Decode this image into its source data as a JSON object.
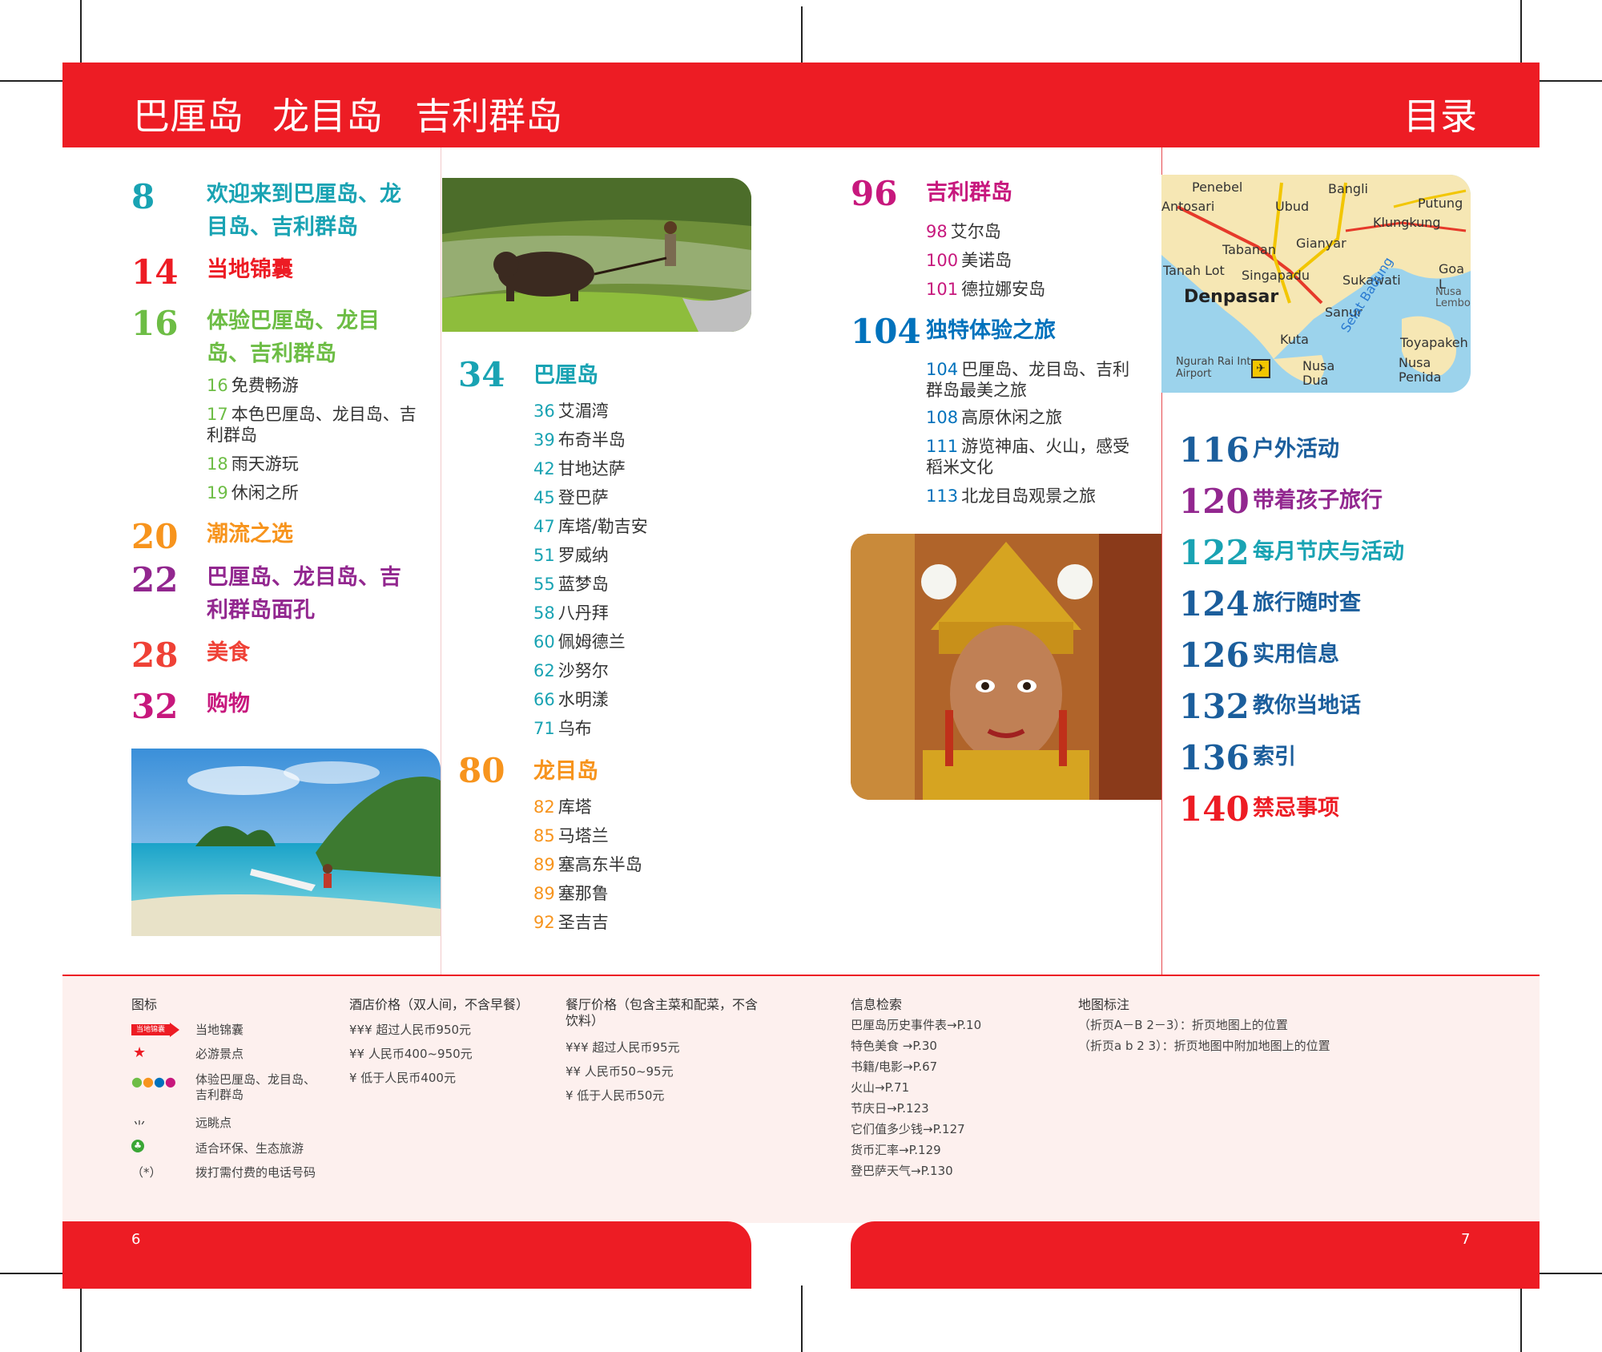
{
  "header": {
    "left_title_1": "巴厘岛",
    "left_title_2": "龙目岛",
    "left_title_3": "吉利群岛",
    "right_title": "目录"
  },
  "toc_col1": [
    {
      "num": "8",
      "title": "欢迎来到巴厘岛、龙目岛、吉利群岛",
      "color": "#19a3b3"
    },
    {
      "num": "14",
      "title": "当地锦囊",
      "color": "#ed1c24"
    },
    {
      "num": "16",
      "title": "体验巴厘岛、龙目岛、吉利群岛",
      "color": "#6dbd45",
      "subs": [
        {
          "n": "16",
          "t": "免费畅游"
        },
        {
          "n": "17",
          "t": "本色巴厘岛、龙目岛、吉利群岛"
        },
        {
          "n": "18",
          "t": "雨天游玩"
        },
        {
          "n": "19",
          "t": "休闲之所"
        }
      ]
    },
    {
      "num": "20",
      "title": "潮流之选",
      "color": "#f7941d"
    },
    {
      "num": "22",
      "title": "巴厘岛、龙目岛、吉利群岛面孔",
      "color": "#92278f"
    },
    {
      "num": "28",
      "title": "美食",
      "color": "#ef4136"
    },
    {
      "num": "32",
      "title": "购物",
      "color": "#c7187d"
    }
  ],
  "toc_col2": [
    {
      "num": "34",
      "title": "巴厘岛",
      "color": "#19a3b3",
      "subs": [
        {
          "n": "36",
          "t": "艾湄湾"
        },
        {
          "n": "39",
          "t": "布奇半岛"
        },
        {
          "n": "42",
          "t": "甘地达萨"
        },
        {
          "n": "45",
          "t": "登巴萨"
        },
        {
          "n": "47",
          "t": "库塔/勒吉安"
        },
        {
          "n": "51",
          "t": "罗威纳"
        },
        {
          "n": "55",
          "t": "蓝梦岛"
        },
        {
          "n": "58",
          "t": "八丹拜"
        },
        {
          "n": "60",
          "t": "佩姆德兰"
        },
        {
          "n": "62",
          "t": "沙努尔"
        },
        {
          "n": "66",
          "t": "水明漾"
        },
        {
          "n": "71",
          "t": "乌布"
        }
      ]
    },
    {
      "num": "80",
      "title": "龙目岛",
      "color": "#f7941d",
      "subs": [
        {
          "n": "82",
          "t": "库塔"
        },
        {
          "n": "85",
          "t": "马塔兰"
        },
        {
          "n": "89",
          "t": "塞高东半岛"
        },
        {
          "n": "89",
          "t": "塞那鲁"
        },
        {
          "n": "92",
          "t": "圣吉吉"
        }
      ]
    }
  ],
  "toc_col3": [
    {
      "num": "96",
      "title": "吉利群岛",
      "color": "#c7187d",
      "subs": [
        {
          "n": "98",
          "t": "艾尔岛"
        },
        {
          "n": "100",
          "t": "美诺岛"
        },
        {
          "n": "101",
          "t": "德拉娜安岛"
        }
      ]
    },
    {
      "num": "104",
      "title": "独特体验之旅",
      "color": "#0072bc",
      "subs": [
        {
          "n": "104",
          "t": "巴厘岛、龙目岛、吉利群岛最美之旅"
        },
        {
          "n": "108",
          "t": "高原休闲之旅"
        },
        {
          "n": "111",
          "t": "游览神庙、火山，感受稻米文化"
        },
        {
          "n": "113",
          "t": "北龙目岛观景之旅"
        }
      ]
    }
  ],
  "toc_col4": [
    {
      "num": "116",
      "title": "户外活动",
      "color": "#1b5e9c"
    },
    {
      "num": "120",
      "title": "带着孩子旅行",
      "color": "#92278f"
    },
    {
      "num": "122",
      "title": "每月节庆与活动",
      "color": "#19a3b3"
    },
    {
      "num": "124",
      "title": "旅行随时查",
      "color": "#1b5e9c"
    },
    {
      "num": "126",
      "title": "实用信息",
      "color": "#1b5e9c"
    },
    {
      "num": "132",
      "title": "教你当地话",
      "color": "#1b5e9c"
    },
    {
      "num": "136",
      "title": "索引",
      "color": "#1b5e9c"
    },
    {
      "num": "140",
      "title": "禁忌事项",
      "color": "#ed1c24"
    }
  ],
  "map": {
    "labels": [
      "Penebel",
      "Antosari",
      "Ubud",
      "Bangli",
      "Putung",
      "Klungkung",
      "Tabanan",
      "Gianyar",
      "Tanah Lot",
      "Singapadu",
      "Sukawati",
      "Goa L",
      "Denpasar",
      "Sanur",
      "Nusa Lembo",
      "Kuta",
      "Toyapakeh",
      "Ngurah Rai Int. Airport",
      "Nusa Dua",
      "Nusa Penida",
      "Selat Badung"
    ]
  },
  "legend": {
    "icons": {
      "title": "图标",
      "badge_text": "当地锦囊",
      "rows": [
        "当地锦囊",
        "必游景点",
        "体验巴厘岛、龙目岛、吉利群岛",
        "远眺点",
        "适合环保、生态旅游",
        "拨打需付费的电话号码"
      ],
      "phone_symbol": "（*）"
    },
    "hotel": {
      "title": "酒店价格（双人间，不含早餐）",
      "rows": [
        "¥¥¥ 超过人民币950元",
        "¥¥ 人民币400~950元",
        "¥ 低于人民币400元"
      ]
    },
    "restaurant": {
      "title": "餐厅价格（包含主菜和配菜，不含饮料）",
      "rows": [
        "¥¥¥ 超过人民币95元",
        "¥¥ 人民币50~95元",
        "¥ 低于人民币50元"
      ]
    },
    "info": {
      "title": "信息检索",
      "rows": [
        "巴厘岛历史事件表→P.10",
        "特色美食 →P.30",
        "书籍/电影→P.67",
        "火山→P.71",
        "节庆日→P.123",
        "它们值多少钱→P.127",
        "货币汇率→P.129",
        "登巴萨天气→P.130"
      ]
    },
    "map": {
      "title": "地图标注",
      "rows": [
        "（折页A－B 2－3）：折页地图上的位置",
        "（折页a   b 2   3）：折页地图中附加地图上的位置"
      ]
    }
  },
  "pages": {
    "left": "6",
    "right": "7"
  },
  "colors": {
    "brand_red": "#ed1c24"
  }
}
